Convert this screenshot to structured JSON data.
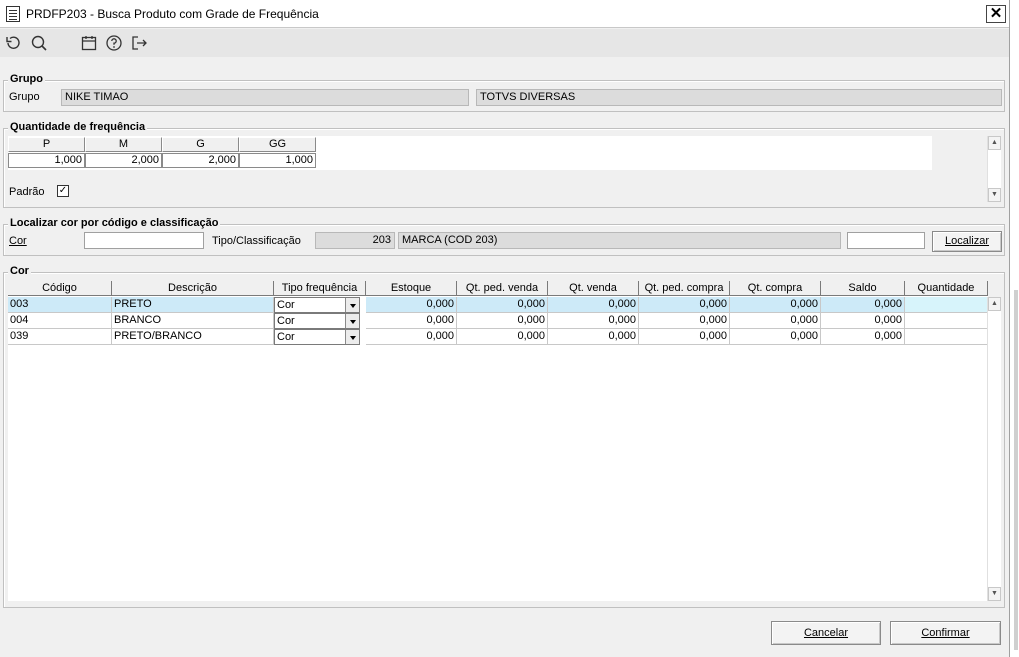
{
  "window": {
    "title": "PRDFP203 - Busca Produto com Grade de Frequência",
    "close_label": "✕"
  },
  "toolbar": {
    "icons": [
      "undo-icon",
      "search-icon",
      "calendar-icon",
      "help-icon",
      "exit-icon"
    ]
  },
  "grupo": {
    "legend": "Grupo",
    "label": "Grupo",
    "value": "NIKE TIMAO",
    "description": "TOTVS DIVERSAS"
  },
  "frequencia": {
    "legend": "Quantidade de frequência",
    "headers": [
      "P",
      "M",
      "G",
      "GG"
    ],
    "values": [
      "1,000",
      "2,000",
      "2,000",
      "1,000"
    ],
    "padrao_label": "Padrão",
    "padrao_checked": "✓"
  },
  "localizar": {
    "legend": "Localizar cor por código e classificação",
    "cor_label": "Cor",
    "cor_value": "",
    "tipo_label": "Tipo/Classificação",
    "tipo_code": "203",
    "tipo_desc": "MARCA (COD 203)",
    "extra_value": "",
    "button_label": "Localizar"
  },
  "cor": {
    "legend": "Cor",
    "columns": [
      "Código",
      "Descrição",
      "Tipo frequência",
      "Estoque",
      "Qt. ped. venda",
      "Qt. venda",
      "Qt. ped. compra",
      "Qt. compra",
      "Saldo",
      "Quantidade"
    ],
    "rows": [
      {
        "codigo": "003",
        "descricao": "PRETO",
        "tipo": "Cor",
        "estoque": "0,000",
        "qt_ped_venda": "0,000",
        "qt_venda": "0,000",
        "qt_ped_compra": "0,000",
        "qt_compra": "0,000",
        "saldo": "0,000",
        "quantidade": ""
      },
      {
        "codigo": "004",
        "descricao": "BRANCO",
        "tipo": "Cor",
        "estoque": "0,000",
        "qt_ped_venda": "0,000",
        "qt_venda": "0,000",
        "qt_ped_compra": "0,000",
        "qt_compra": "0,000",
        "saldo": "0,000",
        "quantidade": ""
      },
      {
        "codigo": "039",
        "descricao": "PRETO/BRANCO",
        "tipo": "Cor",
        "estoque": "0,000",
        "qt_ped_venda": "0,000",
        "qt_venda": "0,000",
        "qt_ped_compra": "0,000",
        "qt_compra": "0,000",
        "saldo": "0,000",
        "quantidade": ""
      }
    ]
  },
  "footer": {
    "cancel_label": "Cancelar",
    "confirm_label": "Confirmar"
  }
}
